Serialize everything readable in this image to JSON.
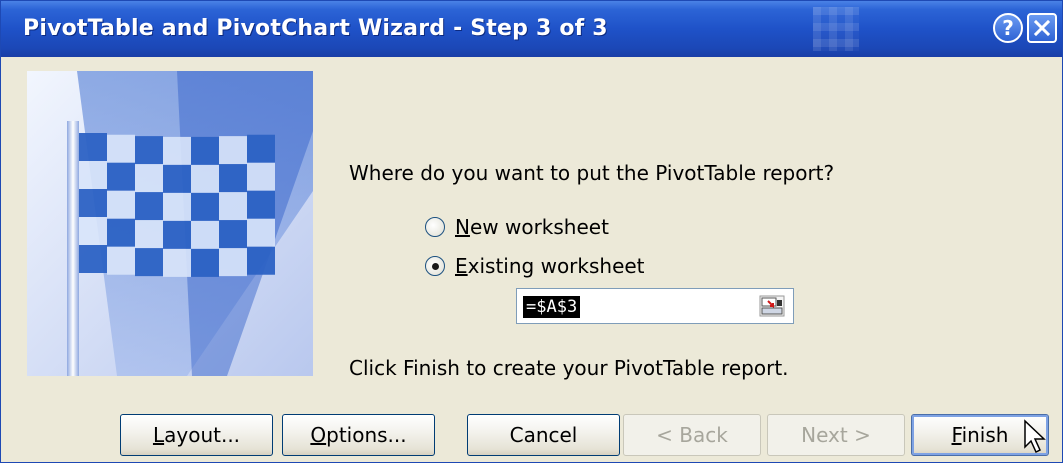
{
  "window": {
    "title": "PivotTable and PivotChart Wizard - Step 3 of 3",
    "help_label": "?",
    "close_label": "×"
  },
  "content": {
    "question": "Where do you want to put the PivotTable report?",
    "options": [
      {
        "label": "New worksheet",
        "checked": false
      },
      {
        "label": "Existing worksheet",
        "checked": true
      }
    ],
    "reference": "=$A$3",
    "instruction": "Click Finish to create your PivotTable report."
  },
  "buttons": {
    "layout": "Layout...",
    "options": "Options...",
    "cancel": "Cancel",
    "back": "< Back",
    "next": "Next >",
    "finish": "Finish"
  },
  "colors": {
    "titlebar": "#1f52c8",
    "dialog_bg": "#ece9d8",
    "flag_dark": "#2c62c4",
    "flag_light": "#d8e4fa"
  }
}
